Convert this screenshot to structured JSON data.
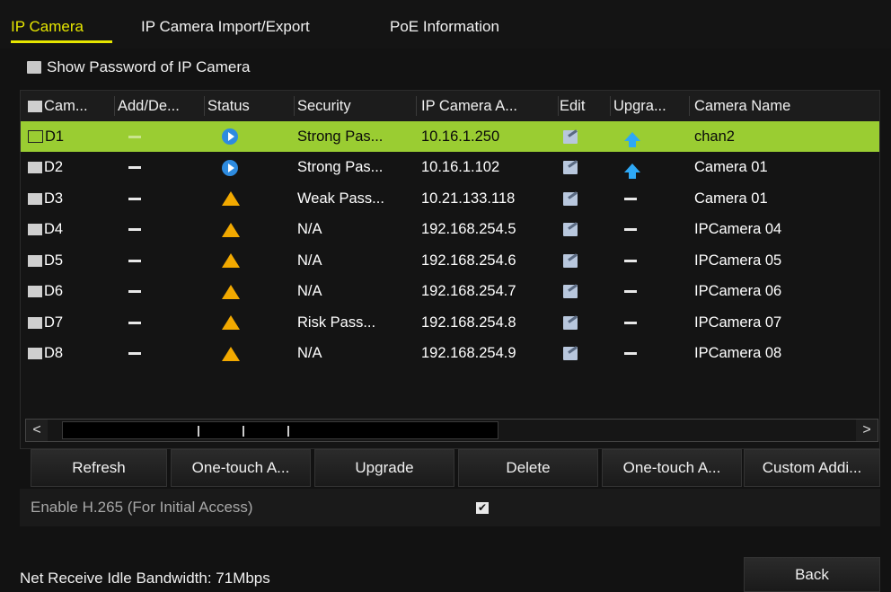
{
  "tabs": [
    {
      "label": "IP Camera",
      "active": true
    },
    {
      "label": "IP Camera Import/Export",
      "active": false
    },
    {
      "label": "PoE Information",
      "active": false
    }
  ],
  "show_password": {
    "label": "Show Password of IP Camera",
    "checked": false
  },
  "table": {
    "columns": [
      "Cam...",
      "Add/De...",
      "Status",
      "Security",
      "IP Camera A...",
      "Edit",
      "Upgra...",
      "Camera Name"
    ],
    "rows": [
      {
        "cam": "D1",
        "status": "play-icon",
        "security": "Strong Pas...",
        "ip": "10.16.1.250",
        "upgrade": "upgrade-icon",
        "name": "chan2",
        "selected": true
      },
      {
        "cam": "D2",
        "status": "play-icon",
        "security": "Strong Pas...",
        "ip": "10.16.1.102",
        "upgrade": "upgrade-icon",
        "name": "Camera 01",
        "selected": false
      },
      {
        "cam": "D3",
        "status": "warning-icon",
        "security": "Weak Pass...",
        "ip": "10.21.133.118",
        "upgrade": "dash",
        "name": "Camera 01",
        "selected": false
      },
      {
        "cam": "D4",
        "status": "warning-icon",
        "security": "N/A",
        "ip": "192.168.254.5",
        "upgrade": "dash",
        "name": "IPCamera 04",
        "selected": false
      },
      {
        "cam": "D5",
        "status": "warning-icon",
        "security": "N/A",
        "ip": "192.168.254.6",
        "upgrade": "dash",
        "name": "IPCamera 05",
        "selected": false
      },
      {
        "cam": "D6",
        "status": "warning-icon",
        "security": "N/A",
        "ip": "192.168.254.7",
        "upgrade": "dash",
        "name": "IPCamera 06",
        "selected": false
      },
      {
        "cam": "D7",
        "status": "warning-icon",
        "security": "Risk Pass...",
        "ip": "192.168.254.8",
        "upgrade": "dash",
        "name": "IPCamera 07",
        "selected": false
      },
      {
        "cam": "D8",
        "status": "warning-icon",
        "security": "N/A",
        "ip": "192.168.254.9",
        "upgrade": "dash",
        "name": "IPCamera 08",
        "selected": false
      }
    ]
  },
  "scrollbar": {
    "left": "<",
    "right": ">"
  },
  "buttons": {
    "refresh": "Refresh",
    "one_touch_add": "One-touch A...",
    "upgrade": "Upgrade",
    "delete": "Delete",
    "one_touch_activate": "One-touch A...",
    "custom_adding": "Custom Addi..."
  },
  "h265": {
    "label": "Enable H.265 (For Initial Access)",
    "checked": true,
    "check_glyph": "✔"
  },
  "bandwidth": "Net Receive Idle Bandwidth: 71Mbps",
  "back": "Back",
  "colors": {
    "accent": "#e6e600",
    "selected_row": "#9acd32",
    "warning": "#f2a900",
    "status_ok": "#2d8be0"
  }
}
